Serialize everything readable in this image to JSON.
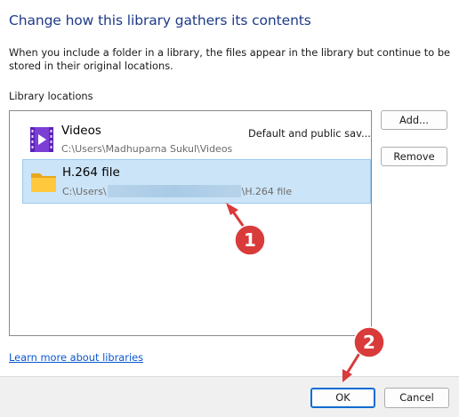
{
  "dialog": {
    "title": "Change how this library gathers its contents",
    "description": "When you include a folder in a library, the files appear in the library but continue to be stored in their original locations.",
    "section_label": "Library locations"
  },
  "locations": [
    {
      "name": "Videos",
      "path": "C:\\Users\\Madhuparna Sukul\\Videos",
      "note": "Default and public sav...",
      "icon": "videos-library-icon",
      "selected": false
    },
    {
      "name": "H.264 file",
      "path_prefix": "C:\\Users\\",
      "path_suffix": "\\H.264 file",
      "icon": "folder-icon",
      "selected": true
    }
  ],
  "buttons": {
    "add": "Add...",
    "remove": "Remove",
    "ok": "OK",
    "cancel": "Cancel"
  },
  "link": {
    "learn_more": "Learn more about libraries"
  },
  "annotations": [
    {
      "label": "1"
    },
    {
      "label": "2"
    }
  ],
  "colors": {
    "title": "#1e3a8a",
    "selection": "#cce4f7",
    "annotation": "#d93a3a",
    "link": "#0b57d0"
  }
}
